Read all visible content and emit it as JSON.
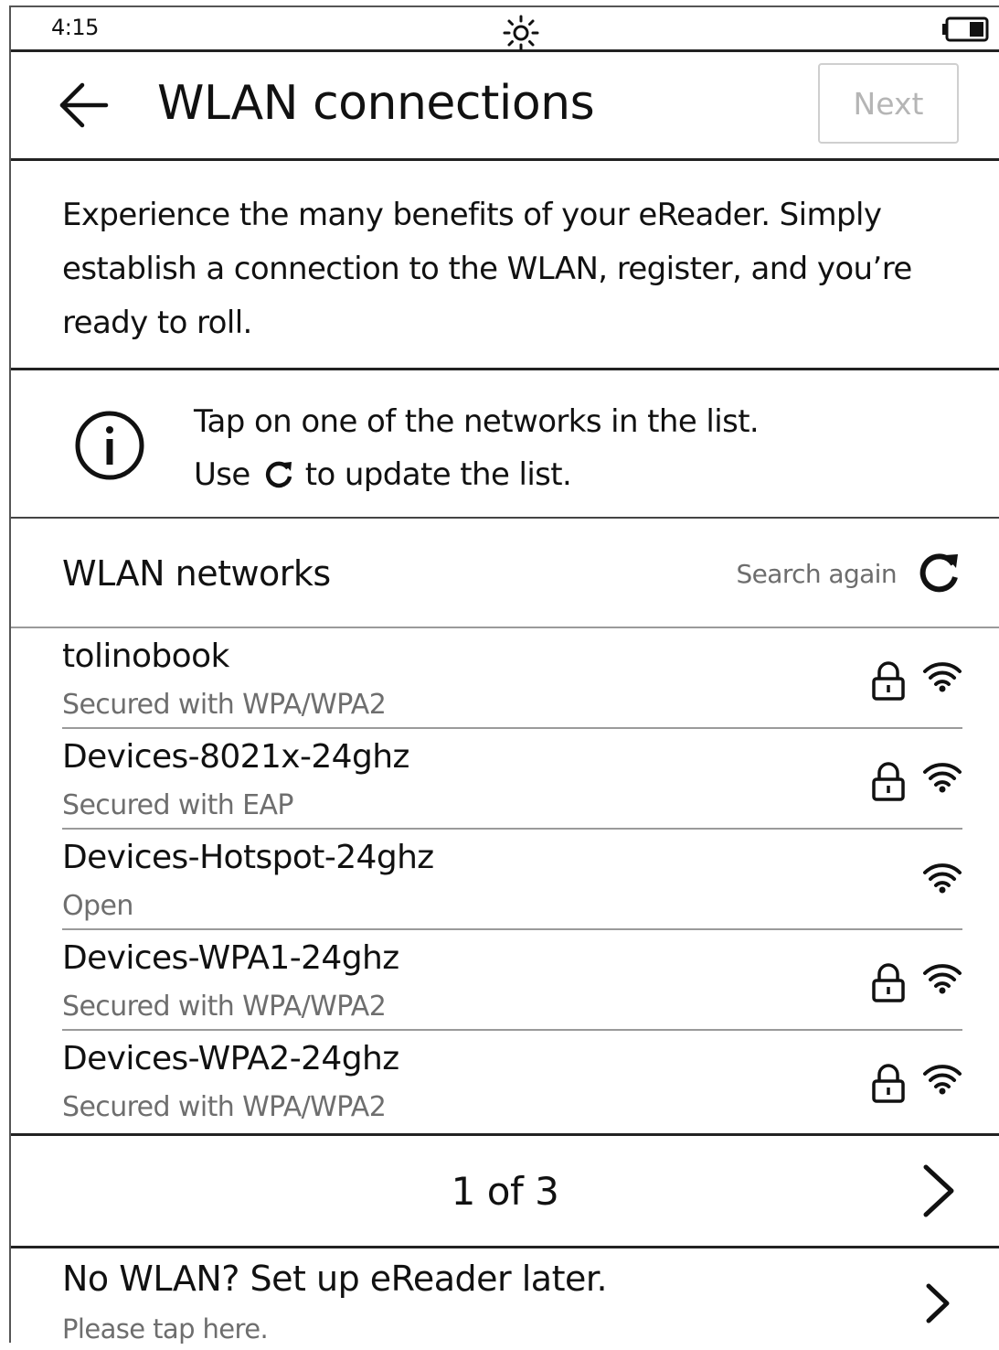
{
  "status_bar": {
    "time": "4:15",
    "light_icon": "frontlight-sun-icon",
    "battery_icon": "battery-icon"
  },
  "header": {
    "back_icon": "back-arrow-icon",
    "title": "WLAN connections",
    "next_label": "Next"
  },
  "intro": {
    "text": "Experience the many benefits of your eReader. Simply establish a connection to the WLAN, register, and you’re ready to roll."
  },
  "info": {
    "icon": "info-icon",
    "line1": "Tap on one of the networks in the list.",
    "line2_prefix": "Use",
    "line2_icon": "refresh-icon",
    "line2_suffix": "to update the list."
  },
  "networks": {
    "title": "WLAN networks",
    "search_again_label": "Search again",
    "search_again_icon": "refresh-icon",
    "items": [
      {
        "name": "tolinobook",
        "security": "Secured with WPA/WPA2",
        "locked": true,
        "icons": [
          "lock-icon",
          "wifi-signal-icon"
        ]
      },
      {
        "name": "Devices-8021x-24ghz",
        "security": "Secured with EAP",
        "locked": true,
        "icons": [
          "lock-icon",
          "wifi-signal-icon"
        ]
      },
      {
        "name": "Devices-Hotspot-24ghz",
        "security": "Open",
        "locked": false,
        "icons": [
          "wifi-signal-icon"
        ]
      },
      {
        "name": "Devices-WPA1-24ghz",
        "security": "Secured with WPA/WPA2",
        "locked": true,
        "icons": [
          "lock-icon",
          "wifi-signal-icon"
        ]
      },
      {
        "name": "Devices-WPA2-24ghz",
        "security": "Secured with WPA/WPA2",
        "locked": true,
        "icons": [
          "lock-icon",
          "wifi-signal-icon"
        ]
      }
    ]
  },
  "pager": {
    "text": "1 of 3",
    "next_icon": "chevron-right-icon"
  },
  "later": {
    "title": "No WLAN? Set up eReader later.",
    "subtitle": "Please tap here.",
    "icon": "chevron-right-icon"
  }
}
